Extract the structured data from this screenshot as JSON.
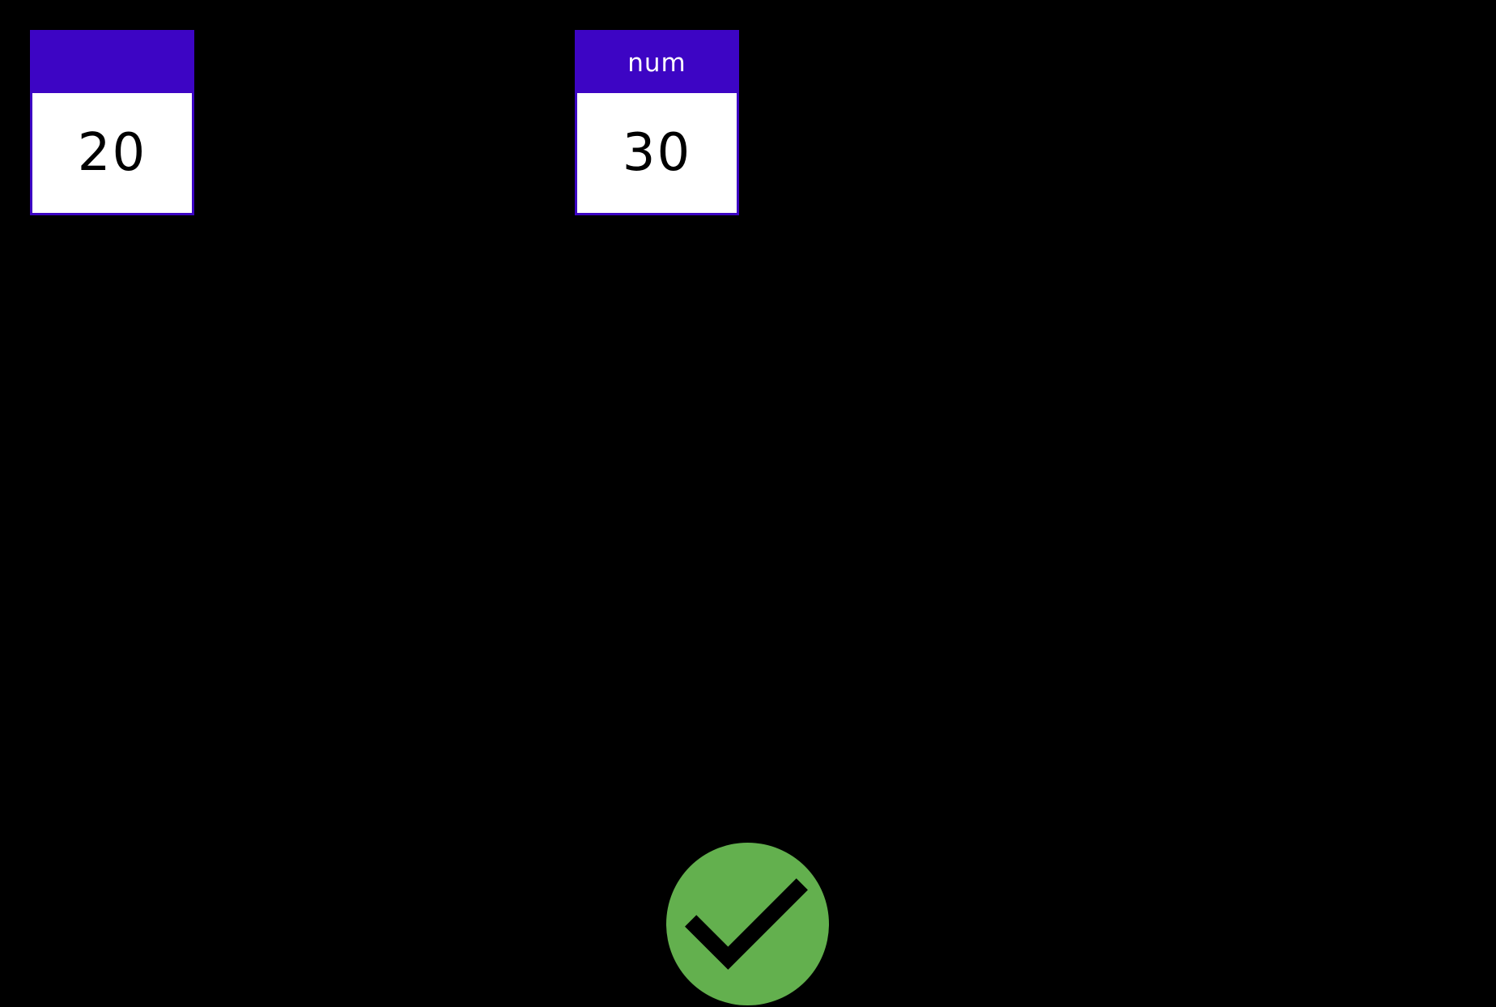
{
  "variables": [
    {
      "name": "",
      "value": "20"
    },
    {
      "name": "num",
      "value": "30"
    }
  ],
  "status": {
    "icon": "check-circle-icon",
    "color": "#63b04e"
  },
  "colors": {
    "background": "#000000",
    "box_accent": "#3d05c4"
  }
}
